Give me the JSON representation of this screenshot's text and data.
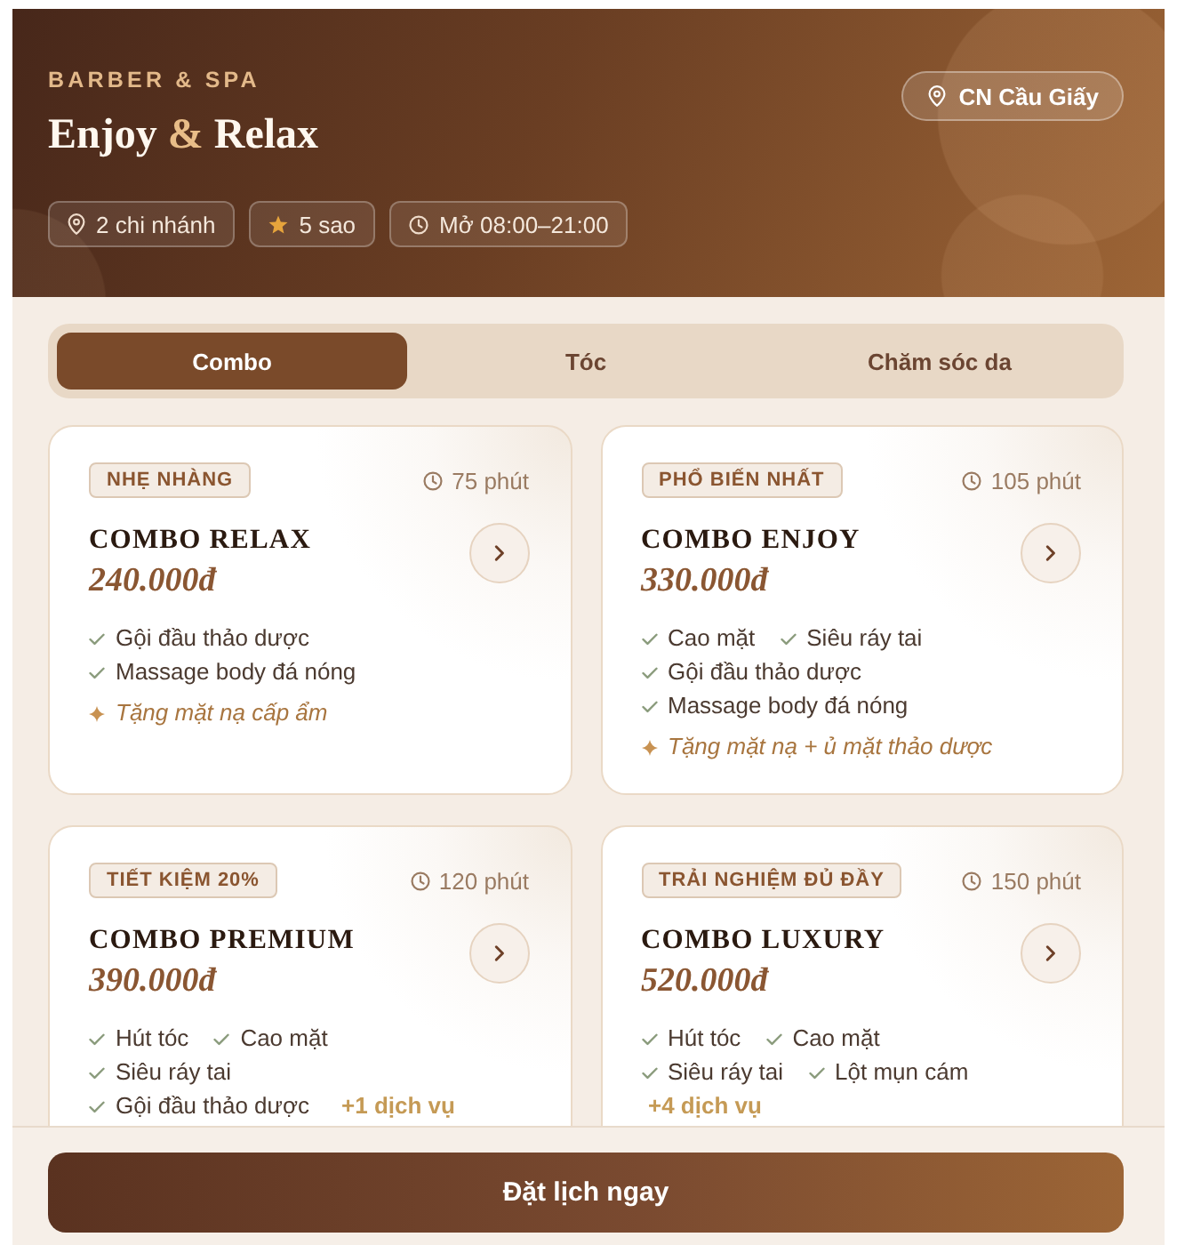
{
  "header": {
    "eyebrow": "BARBER & SPA",
    "title": [
      {
        "text": "Enjoy",
        "accent": false
      },
      {
        "text": "&",
        "accent": true
      },
      {
        "text": "Relax",
        "accent": false
      }
    ],
    "branch_button": {
      "label": "CN Cầu Giấy"
    },
    "chips": [
      {
        "kind": "location",
        "label": "2 chi nhánh"
      },
      {
        "kind": "rating",
        "label": "5 sao"
      },
      {
        "kind": "hours",
        "label": "Mở 08:00–21:00"
      }
    ]
  },
  "tabs": [
    {
      "label": "Combo",
      "selected": true
    },
    {
      "label": "Tóc",
      "selected": false
    },
    {
      "label": "Chăm sóc da",
      "selected": false
    }
  ],
  "combos": [
    {
      "badge": "NHẸ NHÀNG",
      "duration": "75 phút",
      "name": "COMBO RELAX",
      "price": "240.000đ",
      "rows": [
        [
          {
            "kind": "service",
            "text": "Gội đầu thảo dược"
          }
        ],
        [
          {
            "kind": "service",
            "text": "Massage body đá nóng"
          }
        ],
        [
          {
            "kind": "gift",
            "text": "Tặng mặt nạ cấp ẩm"
          }
        ]
      ]
    },
    {
      "badge": "PHỔ BIẾN NHẤT",
      "duration": "105 phút",
      "name": "COMBO ENJOY",
      "price": "330.000đ",
      "rows": [
        [
          {
            "kind": "service",
            "text": "Cao mặt"
          },
          {
            "kind": "service",
            "text": "Siêu ráy tai"
          }
        ],
        [
          {
            "kind": "service",
            "text": "Gội đầu thảo dược"
          }
        ],
        [
          {
            "kind": "service",
            "text": "Massage body đá nóng"
          }
        ],
        [
          {
            "kind": "gift",
            "text": "Tặng mặt nạ + ủ mặt thảo dược"
          }
        ]
      ]
    },
    {
      "badge": "TIẾT KIỆM 20%",
      "duration": "120 phút",
      "name": "COMBO PREMIUM",
      "price": "390.000đ",
      "rows": [
        [
          {
            "kind": "service",
            "text": "Hút tóc"
          },
          {
            "kind": "service",
            "text": "Cao mặt"
          }
        ],
        [
          {
            "kind": "service",
            "text": "Siêu ráy tai"
          }
        ],
        [
          {
            "kind": "service",
            "text": "Gội đầu thảo dược"
          },
          {
            "kind": "more",
            "text": "+1 dịch vụ"
          }
        ]
      ]
    },
    {
      "badge": "TRẢI NGHIỆM ĐỦ ĐẦY",
      "duration": "150 phút",
      "name": "COMBO LUXURY",
      "price": "520.000đ",
      "rows": [
        [
          {
            "kind": "service",
            "text": "Hút tóc"
          },
          {
            "kind": "service",
            "text": "Cao mặt"
          }
        ],
        [
          {
            "kind": "service",
            "text": "Siêu ráy tai"
          },
          {
            "kind": "service",
            "text": "Lột mụn cám"
          }
        ],
        [
          {
            "kind": "more",
            "text": "+4 dịch vụ"
          }
        ]
      ]
    }
  ],
  "footer": {
    "book_button": "Đặt lịch ngay"
  }
}
